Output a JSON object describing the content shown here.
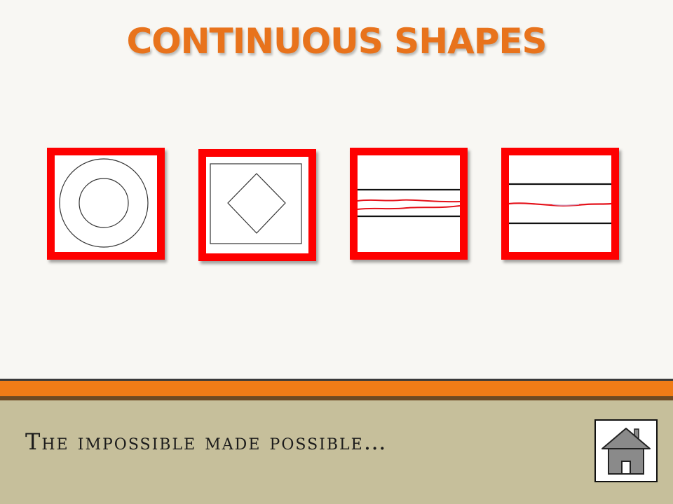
{
  "slide": {
    "title": "CONTINUOUS SHAPES",
    "footer_text": "The impossible made possible…"
  },
  "colors": {
    "title": "#e8731c",
    "tile_border": "#fe0000",
    "accent_band": "#f07c17",
    "footer_background": "#c6bf9b"
  },
  "tiles": [
    {
      "name": "concentric-circles-shape"
    },
    {
      "name": "diamond-in-square-shape"
    },
    {
      "name": "wavy-lines-between-bars-shape"
    },
    {
      "name": "single-wavy-line-between-bars-shape"
    }
  ],
  "navigation": {
    "home_icon": "home-icon"
  }
}
